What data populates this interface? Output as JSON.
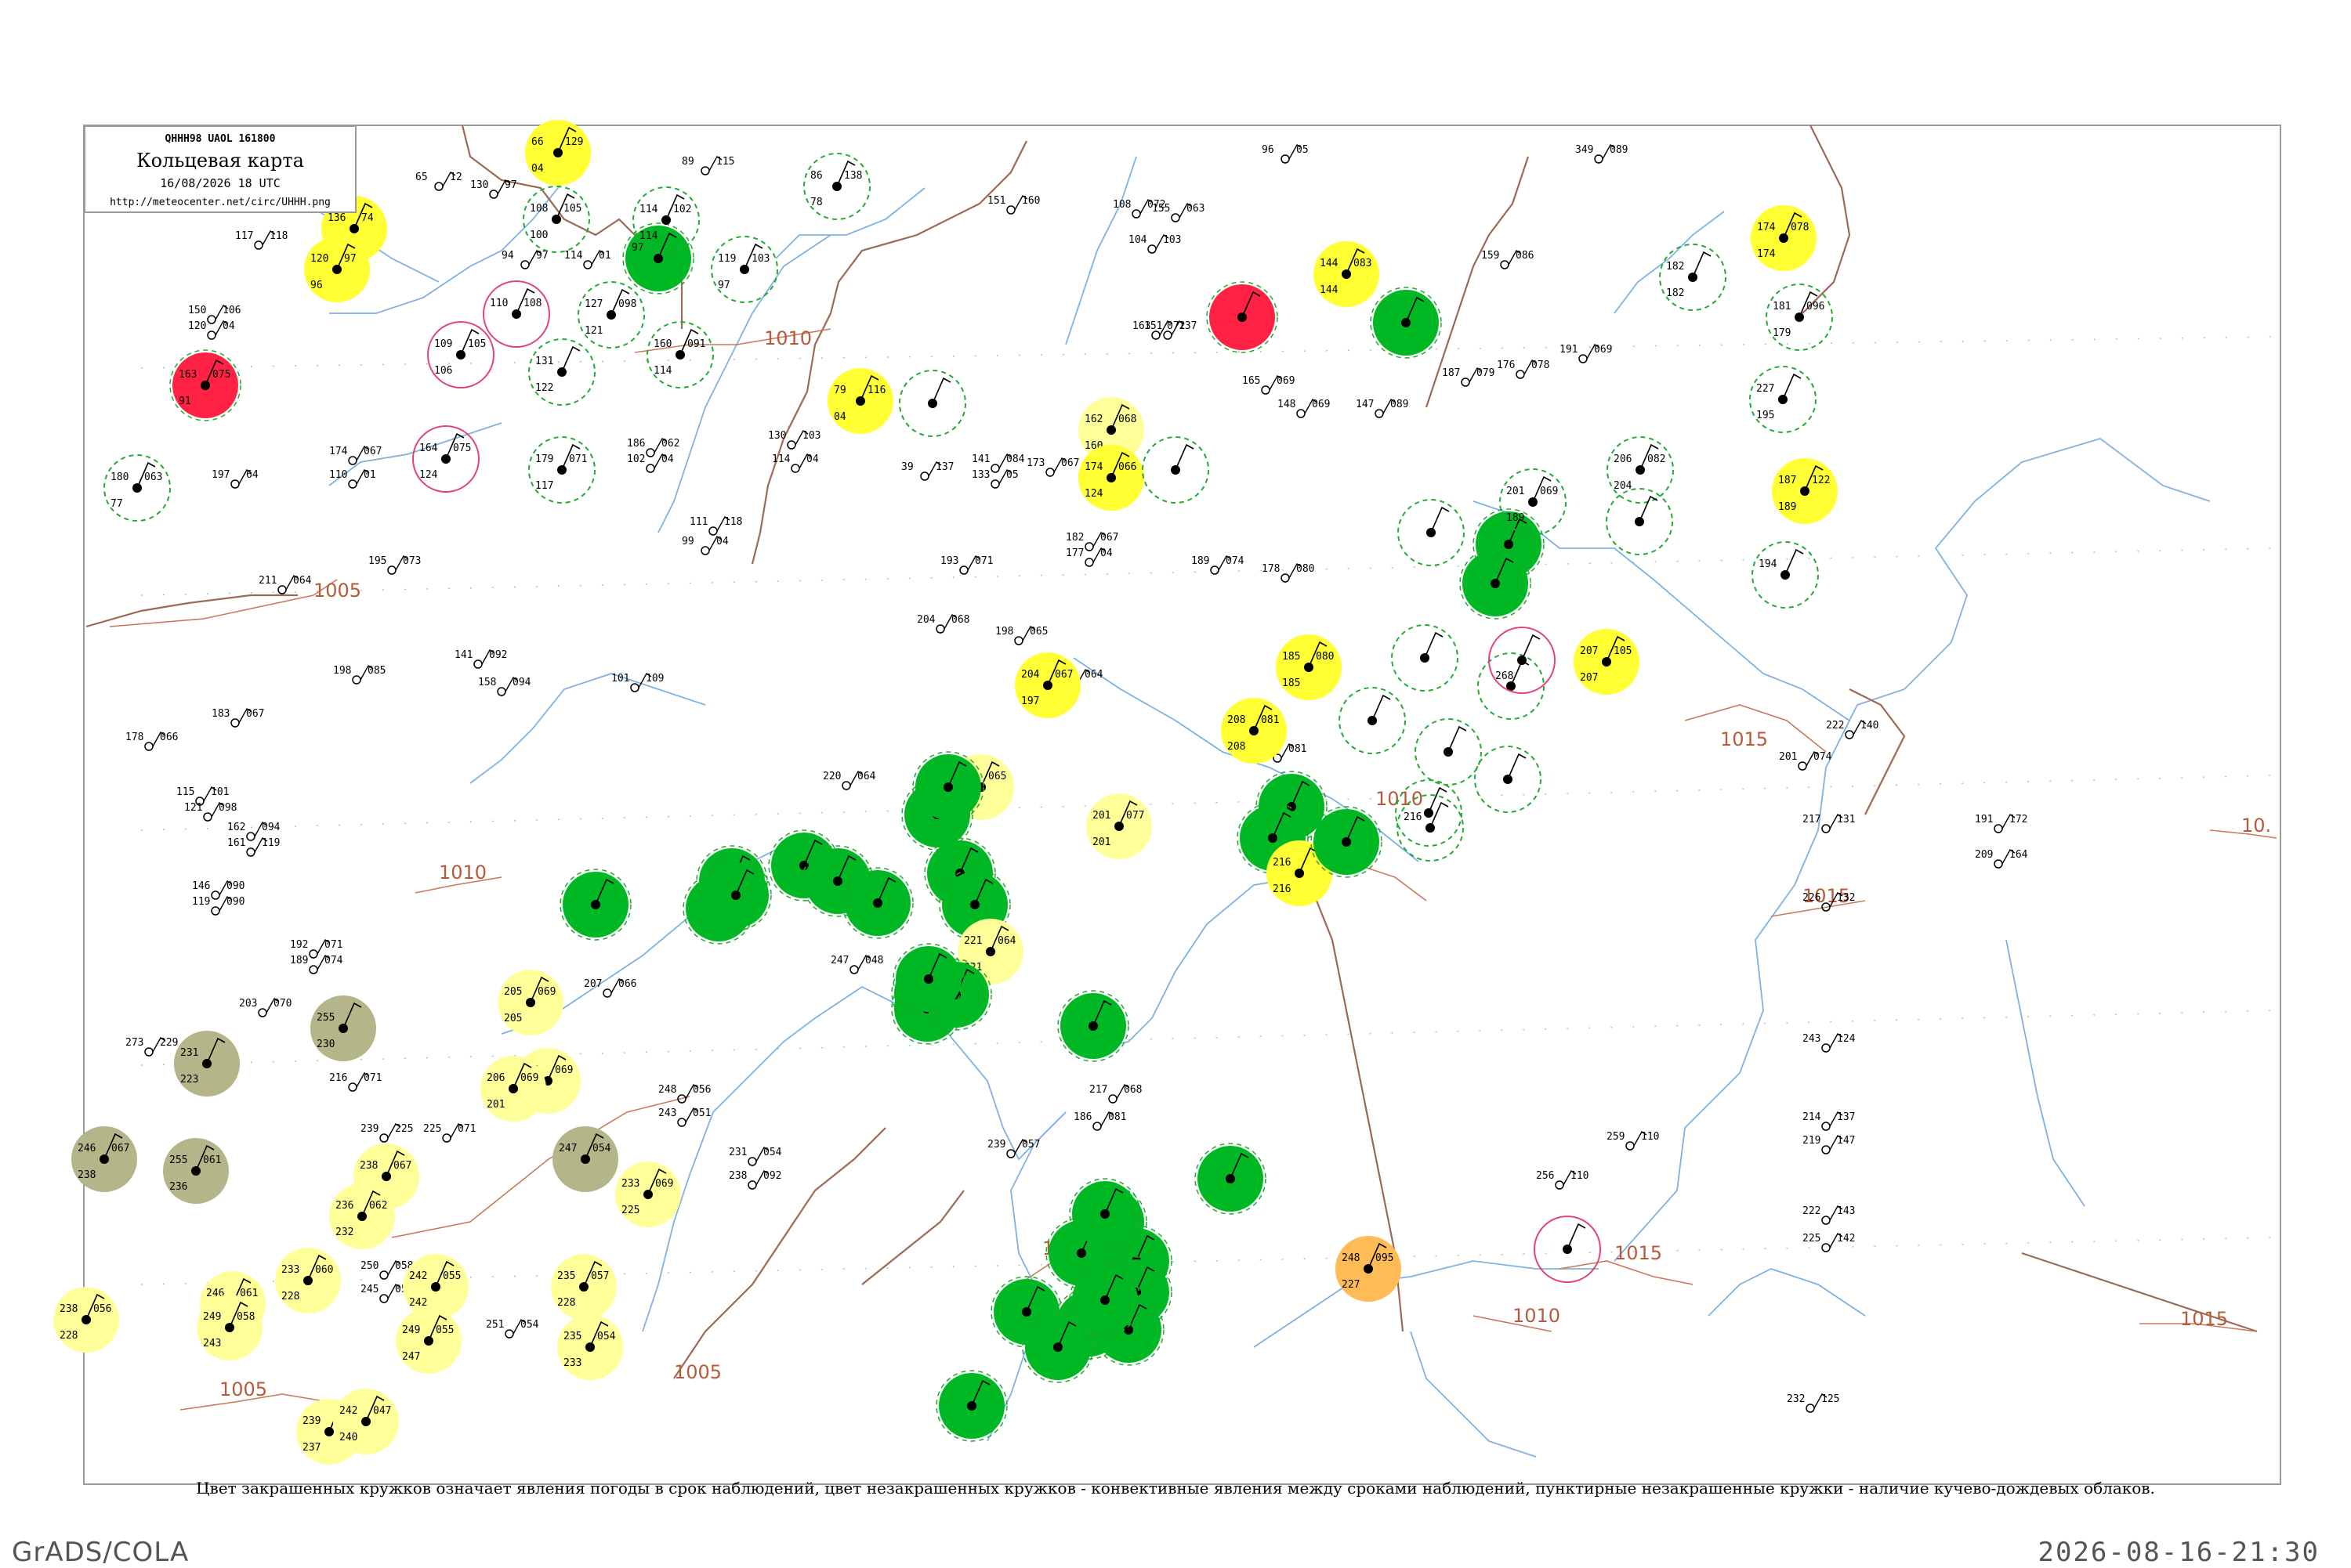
{
  "legend": {
    "code": "QHHH98  UAOL  161800",
    "title": "Кольцевая карта",
    "datetime": "16/08/2026 18 UTC",
    "url": "http://meteocenter.net/circ/UHHH.png"
  },
  "caption": "Цвет закрашенных кружков означает явления погоды в срок наблюдений, цвет незакрашенных кружков - конвективные явления между сроками наблюдений, пунктирные незакрашенные кружки - наличие кучево-дождевых облаков.",
  "footer": {
    "left": "GrADS/COLA",
    "right": "2026-08-16-21:30"
  },
  "colors": {
    "river": "#7fb2e0",
    "border": "#9b6a55",
    "isobar": "#c8795e",
    "green": "#00b824",
    "yellow": "#ffff33",
    "paleyellow": "#ffff99",
    "red": "#ff2244",
    "olive": "#b5b58a",
    "orange": "#ffbb55",
    "dashedring": "#22aa33",
    "pinkring": "#e0457a"
  },
  "isobars": [
    {
      "label": "1005"
    },
    {
      "label": "1010"
    },
    {
      "label": "1015"
    },
    {
      "label": "1010"
    },
    {
      "label": "1005"
    },
    {
      "label": "1005"
    },
    {
      "label": "1015"
    },
    {
      "label": "1005"
    },
    {
      "label": "1010"
    },
    {
      "label": "1010"
    },
    {
      "label": "1015"
    },
    {
      "label": "1015"
    },
    {
      "label": "10."
    }
  ],
  "stations": [
    {
      "kind": "red",
      "label": "163",
      "a": "075",
      "b": "91"
    },
    {
      "kind": "yellow",
      "label": "136",
      "a": "74",
      "b": "02"
    },
    {
      "kind": "yellow",
      "label": "120",
      "a": "97",
      "b": "96"
    },
    {
      "kind": "yellow",
      "label": "66",
      "a": "129",
      "b": "04"
    },
    {
      "kind": "green",
      "label": "97",
      "a": "",
      "b": ""
    },
    {
      "kind": "dashed",
      "label": "86",
      "a": "138",
      "b": "78"
    },
    {
      "kind": "dashed",
      "label": "119",
      "a": "103",
      "b": "97"
    },
    {
      "kind": "yellow",
      "label": "79",
      "a": "116",
      "b": "04"
    },
    {
      "kind": "red",
      "label": "",
      "a": "",
      "b": ""
    },
    {
      "kind": "yellow",
      "label": "144",
      "a": "083",
      "b": "144"
    },
    {
      "kind": "green",
      "label": "",
      "a": "",
      "b": ""
    },
    {
      "kind": "yellow",
      "label": "174",
      "a": "078",
      "b": "174"
    },
    {
      "kind": "paleyellow",
      "label": "162",
      "a": "068",
      "b": "160"
    },
    {
      "kind": "yellow",
      "label": "174",
      "a": "066",
      "b": "124"
    },
    {
      "kind": "yellow",
      "label": "187",
      "a": "122",
      "b": "189"
    },
    {
      "kind": "green",
      "label": "",
      "a": "",
      "b": ""
    },
    {
      "kind": "green",
      "label": "",
      "a": "",
      "b": ""
    },
    {
      "kind": "yellow",
      "label": "185",
      "a": "080",
      "b": "185"
    },
    {
      "kind": "yellow",
      "label": "207",
      "a": "105",
      "b": "207"
    },
    {
      "kind": "yellow",
      "label": "204",
      "a": "067",
      "b": "197"
    },
    {
      "kind": "yellow",
      "label": "208",
      "a": "081",
      "b": "208"
    },
    {
      "kind": "green",
      "label": "",
      "a": "",
      "b": ""
    },
    {
      "kind": "green",
      "label": "",
      "a": "",
      "b": ""
    },
    {
      "kind": "yellow",
      "label": "216",
      "a": "",
      "b": "216"
    },
    {
      "kind": "green",
      "label": "",
      "a": "",
      "b": ""
    },
    {
      "kind": "paleyellow",
      "label": "209",
      "a": "065",
      "b": "209"
    },
    {
      "kind": "paleyellow",
      "label": "201",
      "a": "077",
      "b": "201"
    },
    {
      "kind": "green",
      "label": "",
      "a": "",
      "b": ""
    },
    {
      "kind": "green",
      "label": "",
      "a": "",
      "b": ""
    },
    {
      "kind": "green",
      "label": "",
      "a": "",
      "b": ""
    },
    {
      "kind": "green",
      "label": "",
      "a": "",
      "b": ""
    },
    {
      "kind": "green",
      "label": "",
      "a": "",
      "b": ""
    },
    {
      "kind": "green",
      "label": "",
      "a": "",
      "b": ""
    },
    {
      "kind": "green",
      "label": "",
      "a": "",
      "b": ""
    },
    {
      "kind": "green",
      "label": "",
      "a": "",
      "b": ""
    },
    {
      "kind": "green",
      "label": "",
      "a": "",
      "b": ""
    },
    {
      "kind": "green",
      "label": "",
      "a": "",
      "b": ""
    },
    {
      "kind": "green",
      "label": "",
      "a": "",
      "b": ""
    },
    {
      "kind": "green",
      "label": "",
      "a": "",
      "b": ""
    },
    {
      "kind": "green",
      "label": "",
      "a": "",
      "b": ""
    },
    {
      "kind": "green",
      "label": "",
      "a": "",
      "b": ""
    },
    {
      "kind": "green",
      "label": "",
      "a": "",
      "b": ""
    },
    {
      "kind": "orange",
      "label": "248",
      "a": "095",
      "b": "227"
    },
    {
      "kind": "paleyellow",
      "label": "221",
      "a": "064",
      "b": "221"
    },
    {
      "kind": "paleyellow",
      "label": "205",
      "a": "069",
      "b": "205"
    },
    {
      "kind": "paleyellow",
      "label": "221",
      "a": "069",
      "b": "221"
    },
    {
      "kind": "paleyellow",
      "label": "206",
      "a": "069",
      "b": "201"
    },
    {
      "kind": "olive",
      "label": "231",
      "a": "",
      "b": "223"
    },
    {
      "kind": "olive",
      "label": "255",
      "a": "",
      "b": "230"
    },
    {
      "kind": "olive",
      "label": "246",
      "a": "067",
      "b": "238"
    },
    {
      "kind": "olive",
      "label": "255",
      "a": "061",
      "b": "236"
    },
    {
      "kind": "olive",
      "label": "247",
      "a": "054",
      "b": ""
    },
    {
      "kind": "paleyellow",
      "label": "233",
      "a": "069",
      "b": "225"
    },
    {
      "kind": "paleyellow",
      "label": "238",
      "a": "067",
      "b": "233"
    },
    {
      "kind": "paleyellow",
      "label": "236",
      "a": "062",
      "b": "232"
    },
    {
      "kind": "paleyellow",
      "label": "233",
      "a": "060",
      "b": "228"
    },
    {
      "kind": "paleyellow",
      "label": "246",
      "a": "061",
      "b": "238"
    },
    {
      "kind": "paleyellow",
      "label": "249",
      "a": "058",
      "b": "243"
    },
    {
      "kind": "paleyellow",
      "label": "238",
      "a": "056",
      "b": "228"
    },
    {
      "kind": "paleyellow",
      "label": "242",
      "a": "055",
      "b": "242"
    },
    {
      "kind": "paleyellow",
      "label": "249",
      "a": "055",
      "b": "247"
    },
    {
      "kind": "paleyellow",
      "label": "235",
      "a": "057",
      "b": "228"
    },
    {
      "kind": "paleyellow",
      "label": "235",
      "a": "054",
      "b": "233"
    },
    {
      "kind": "paleyellow",
      "label": "239",
      "a": "056",
      "b": "237"
    },
    {
      "kind": "paleyellow",
      "label": "242",
      "a": "047",
      "b": "240"
    },
    {
      "kind": "green",
      "label": "",
      "a": "",
      "b": ""
    },
    {
      "kind": "green",
      "label": "",
      "a": "",
      "b": ""
    },
    {
      "kind": "green",
      "label": "",
      "a": "",
      "b": ""
    },
    {
      "kind": "green",
      "label": "",
      "a": "",
      "b": ""
    },
    {
      "kind": "green",
      "label": "",
      "a": "",
      "b": ""
    },
    {
      "kind": "green",
      "label": "",
      "a": "",
      "b": ""
    },
    {
      "kind": "green",
      "label": "",
      "a": "",
      "b": ""
    },
    {
      "kind": "green",
      "label": "",
      "a": "",
      "b": ""
    },
    {
      "kind": "green",
      "label": "",
      "a": "",
      "b": ""
    },
    {
      "kind": "green",
      "label": "",
      "a": "",
      "b": ""
    },
    {
      "kind": "green",
      "label": "",
      "a": "",
      "b": ""
    },
    {
      "kind": "green",
      "label": "",
      "a": "",
      "b": ""
    },
    {
      "kind": "green",
      "label": "",
      "a": "",
      "b": ""
    },
    {
      "kind": "dashed",
      "label": "108",
      "a": "105",
      "b": "100"
    },
    {
      "kind": "dashed",
      "label": "114",
      "a": "102",
      "b": "114"
    },
    {
      "kind": "dashed",
      "label": "127",
      "a": "098",
      "b": "121"
    },
    {
      "kind": "dashed",
      "label": "131",
      "a": "",
      "b": "122"
    },
    {
      "kind": "dashed",
      "label": "160",
      "a": "091",
      "b": "114"
    },
    {
      "kind": "dashed",
      "label": "179",
      "a": "071",
      "b": "117"
    },
    {
      "kind": "dashed",
      "label": "180",
      "a": "063",
      "b": "77"
    },
    {
      "kind": "pink",
      "label": "109",
      "a": "105",
      "b": "106"
    },
    {
      "kind": "pink",
      "label": "110",
      "a": "108",
      "b": ""
    },
    {
      "kind": "pink",
      "label": "164",
      "a": "075",
      "b": "124"
    },
    {
      "kind": "dashed",
      "label": "",
      "a": "",
      "b": ""
    },
    {
      "kind": "dashed",
      "label": "",
      "a": "",
      "b": ""
    },
    {
      "kind": "dashed",
      "label": "182",
      "a": "",
      "b": "182"
    },
    {
      "kind": "dashed",
      "label": "181",
      "a": "096",
      "b": "179"
    },
    {
      "kind": "dashed",
      "label": "227",
      "a": "",
      "b": "195"
    },
    {
      "kind": "dashed",
      "label": "206",
      "a": "082",
      "b": "204"
    },
    {
      "kind": "dashed",
      "label": "194",
      "a": "",
      "b": ""
    },
    {
      "kind": "dashed",
      "label": "",
      "a": "",
      "b": ""
    },
    {
      "kind": "dashed",
      "label": "",
      "a": "",
      "b": ""
    },
    {
      "kind": "dashed",
      "label": "201",
      "a": "069",
      "b": "189"
    },
    {
      "kind": "dashed",
      "label": "",
      "a": "",
      "b": ""
    },
    {
      "kind": "dashed",
      "label": "216",
      "a": "",
      "b": ""
    },
    {
      "kind": "dashed",
      "label": "",
      "a": "",
      "b": ""
    },
    {
      "kind": "dashed",
      "label": "",
      "a": "",
      "b": ""
    },
    {
      "kind": "dashed",
      "label": "",
      "a": "",
      "b": ""
    },
    {
      "kind": "dashed",
      "label": "",
      "a": "",
      "b": ""
    },
    {
      "kind": "dashed",
      "label": "",
      "a": "",
      "b": ""
    },
    {
      "kind": "pink",
      "label": "",
      "a": "",
      "b": "268"
    },
    {
      "kind": "pink",
      "label": "",
      "a": "",
      "b": ""
    }
  ],
  "obs": [
    {
      "t": "89",
      "v": "115"
    },
    {
      "t": "65",
      "v": "12"
    },
    {
      "t": "130",
      "v": "97"
    },
    {
      "t": "117",
      "v": "118"
    },
    {
      "t": "94",
      "v": "97"
    },
    {
      "t": "114",
      "v": "01"
    },
    {
      "t": "150",
      "v": "106"
    },
    {
      "t": "120",
      "v": "04"
    },
    {
      "t": "174",
      "v": "067"
    },
    {
      "t": "110",
      "v": "01"
    },
    {
      "t": "197",
      "v": "64"
    },
    {
      "t": "211",
      "v": "064"
    },
    {
      "t": "195",
      "v": "073"
    },
    {
      "t": "186",
      "v": "062"
    },
    {
      "t": "102",
      "v": "04"
    },
    {
      "t": "130",
      "v": "103"
    },
    {
      "t": "114",
      "v": "04"
    },
    {
      "t": "111",
      "v": "118"
    },
    {
      "t": "99",
      "v": "04"
    },
    {
      "t": "141",
      "v": "084"
    },
    {
      "t": "133",
      "v": "05"
    },
    {
      "t": "173",
      "v": "067"
    },
    {
      "t": "182",
      "v": "067"
    },
    {
      "t": "177",
      "v": "04"
    },
    {
      "t": "193",
      "v": "071"
    },
    {
      "t": "204",
      "v": "068"
    },
    {
      "t": "198",
      "v": "065"
    },
    {
      "t": "221",
      "v": "064"
    },
    {
      "t": "184",
      "v": "081"
    },
    {
      "t": "141",
      "v": "092"
    },
    {
      "t": "158",
      "v": "094"
    },
    {
      "t": "101",
      "v": "109"
    },
    {
      "t": "178",
      "v": "066"
    },
    {
      "t": "183",
      "v": "067"
    },
    {
      "t": "198",
      "v": "085"
    },
    {
      "t": "220",
      "v": "064"
    },
    {
      "t": "226",
      "v": "068"
    },
    {
      "t": "115",
      "v": "101"
    },
    {
      "t": "121",
      "v": "098"
    },
    {
      "t": "162",
      "v": "094"
    },
    {
      "t": "161",
      "v": "119"
    },
    {
      "t": "146",
      "v": "090"
    },
    {
      "t": "119",
      "v": "090"
    },
    {
      "t": "192",
      "v": "071"
    },
    {
      "t": "189",
      "v": "074"
    },
    {
      "t": "203",
      "v": "070"
    },
    {
      "t": "273",
      "v": "229"
    },
    {
      "t": "216",
      "v": "071"
    },
    {
      "t": "239",
      "v": "225"
    },
    {
      "t": "225",
      "v": "071"
    },
    {
      "t": "250",
      "v": "058"
    },
    {
      "t": "245",
      "v": "056"
    },
    {
      "t": "251",
      "v": "054"
    },
    {
      "t": "207",
      "v": "066"
    },
    {
      "t": "248",
      "v": "056"
    },
    {
      "t": "243",
      "v": "051"
    },
    {
      "t": "231",
      "v": "054"
    },
    {
      "t": "238",
      "v": "092"
    },
    {
      "t": "247",
      "v": "048"
    },
    {
      "t": "239",
      "v": "057"
    },
    {
      "t": "186",
      "v": "081"
    },
    {
      "t": "217",
      "v": "068"
    },
    {
      "t": "259",
      "v": "110"
    },
    {
      "t": "256",
      "v": "110"
    },
    {
      "t": "201",
      "v": "074"
    },
    {
      "t": "222",
      "v": "140"
    },
    {
      "t": "217",
      "v": "131"
    },
    {
      "t": "226",
      "v": "132"
    },
    {
      "t": "243",
      "v": "124"
    },
    {
      "t": "214",
      "v": "137"
    },
    {
      "t": "219",
      "v": "147"
    },
    {
      "t": "222",
      "v": "143"
    },
    {
      "t": "225",
      "v": "142"
    },
    {
      "t": "232",
      "v": "125"
    },
    {
      "t": "191",
      "v": "172"
    },
    {
      "t": "209",
      "v": "164"
    },
    {
      "t": "151",
      "v": "137"
    },
    {
      "t": "349",
      "v": "089"
    },
    {
      "t": "159",
      "v": "086"
    },
    {
      "t": "191",
      "v": "069"
    },
    {
      "t": "176",
      "v": "078"
    },
    {
      "t": "187",
      "v": "079"
    },
    {
      "t": "165",
      "v": "069"
    },
    {
      "t": "148",
      "v": "069"
    },
    {
      "t": "147",
      "v": "089"
    },
    {
      "t": "189",
      "v": "074"
    },
    {
      "t": "178",
      "v": "080"
    },
    {
      "t": "108",
      "v": "072"
    },
    {
      "t": "155",
      "v": "063"
    },
    {
      "t": "104",
      "v": "103"
    },
    {
      "t": "151",
      "v": "160"
    },
    {
      "t": "163",
      "v": "072"
    },
    {
      "t": "96",
      "v": "05"
    },
    {
      "t": "39",
      "v": "137"
    }
  ]
}
